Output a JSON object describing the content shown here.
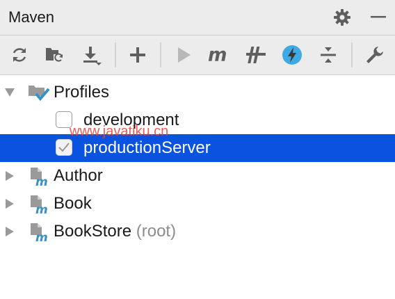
{
  "window": {
    "title": "Maven"
  },
  "toolbar": {
    "buttons": [
      {
        "name": "reload-all-projects",
        "icon": "refresh-icon"
      },
      {
        "name": "generate-sources",
        "icon": "folder-refresh-icon"
      },
      {
        "name": "download-sources",
        "icon": "download-icon"
      },
      {
        "name": "add-maven-project",
        "icon": "plus-icon"
      },
      {
        "name": "run-maven-build",
        "icon": "run-icon"
      },
      {
        "name": "execute-maven-goal",
        "icon": "maven-m-icon"
      },
      {
        "name": "toggle-offline-mode",
        "icon": "offline-toggle-icon"
      },
      {
        "name": "toggle-skip-tests",
        "icon": "lightning-icon"
      },
      {
        "name": "collapse-all",
        "icon": "collapse-icon"
      },
      {
        "name": "maven-settings",
        "icon": "wrench-icon"
      }
    ]
  },
  "tree": {
    "profiles": {
      "label": "Profiles",
      "items": [
        {
          "label": "development",
          "checked": false,
          "selected": false
        },
        {
          "label": "productionServer",
          "checked": true,
          "selected": true
        }
      ]
    },
    "modules": [
      {
        "label": "Author",
        "suffix": ""
      },
      {
        "label": "Book",
        "suffix": ""
      },
      {
        "label": "BookStore",
        "suffix": "(root)"
      }
    ]
  },
  "watermark": "www.javatiku.cn",
  "colors": {
    "selection": "#0a52e0",
    "toolbar_bg": "#ececec",
    "accent_blue": "#3fa9e6",
    "checkmark_blue": "#3592c4"
  }
}
